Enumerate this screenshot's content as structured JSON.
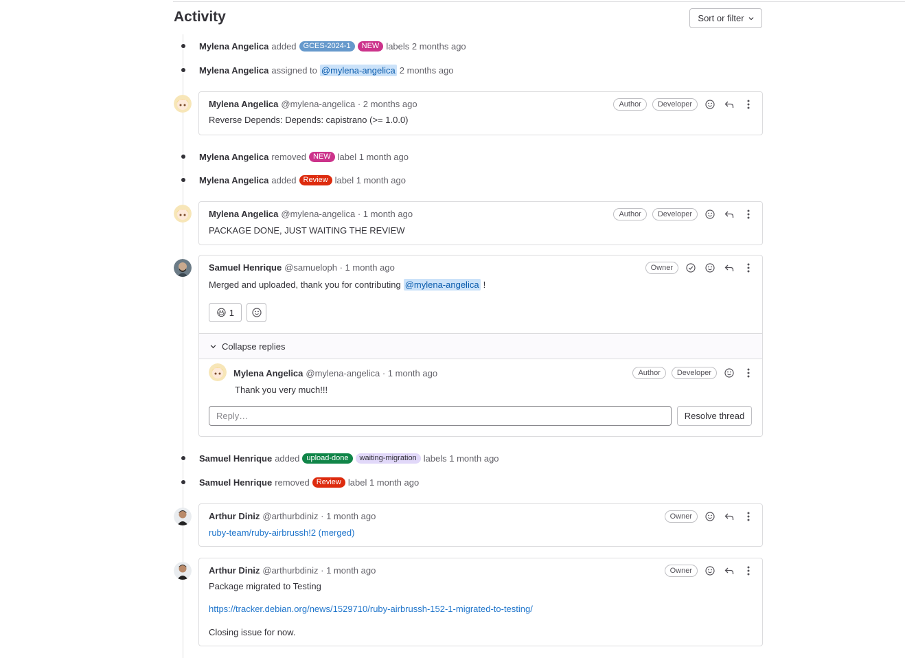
{
  "page": {
    "title": "Activity",
    "sort_label": "Sort or filter"
  },
  "colors": {
    "gces": "#6699cc",
    "new": "#cc338b",
    "review": "#dd2b0e",
    "upload_done": "#108548",
    "waiting_migration": "#e1d8f9"
  },
  "events": [
    {
      "who": "Mylena Angelica",
      "pre": "added",
      "labels": [
        "GCES-2024-1",
        "NEW"
      ],
      "post": "labels 2 months ago"
    },
    {
      "who": "Mylena Angelica",
      "pre": "assigned to",
      "mention": "@mylena-angelica",
      "post": "2 months ago"
    },
    {
      "who": "Mylena Angelica",
      "pre": "removed",
      "labels": [
        "NEW"
      ],
      "post": "label 1 month ago"
    },
    {
      "who": "Mylena Angelica",
      "pre": "added",
      "labels": [
        "Review"
      ],
      "post": "label 1 month ago"
    },
    {
      "who": "Samuel Henrique",
      "pre": "added",
      "labels": [
        "upload-done",
        "waiting-migration"
      ],
      "post": "labels 1 month ago"
    },
    {
      "who": "Samuel Henrique",
      "pre": "removed",
      "labels": [
        "Review"
      ],
      "post": "label 1 month ago"
    }
  ],
  "notes": [
    {
      "who": "Mylena Angelica",
      "meta": "@mylena-angelica · 2 months ago",
      "badges": [
        "Author",
        "Developer"
      ],
      "text": "Reverse Depends: Depends: capistrano (>= 1.0.0)"
    },
    {
      "who": "Mylena Angelica",
      "meta": "@mylena-angelica · 1 month ago",
      "badges": [
        "Author",
        "Developer"
      ],
      "text": "PACKAGE DONE, JUST WAITING THE REVIEW"
    },
    {
      "who": "Samuel Henrique",
      "meta": "@samueloph · 1 month ago",
      "badges": [
        "Owner"
      ],
      "text": "Merged and uploaded, thank you for contributing",
      "mention": "@mylena-angelica",
      "suffix": "!",
      "reaction_count": "1",
      "collapse": "Collapse replies",
      "reply": {
        "who": "Mylena Angelica",
        "meta": "@mylena-angelica · 1 month ago",
        "badges": [
          "Author",
          "Developer"
        ],
        "text": "Thank you very much!!!"
      },
      "reply_placeholder": "Reply…",
      "resolve": "Resolve thread"
    },
    {
      "who": "Arthur Diniz",
      "meta": "@arthurbdiniz · 1 month ago",
      "badges": [
        "Owner"
      ],
      "link": "ruby-team/ruby-airbrussh!2 (merged)"
    },
    {
      "who": "Arthur Diniz",
      "meta": "@arthurbdiniz · 1 month ago",
      "badges": [
        "Owner"
      ],
      "lines": [
        "Package migrated to Testing",
        "https://tracker.debian.org/news/1529710/ruby-airbrussh-152-1-migrated-to-testing/",
        "Closing issue for now."
      ]
    }
  ]
}
